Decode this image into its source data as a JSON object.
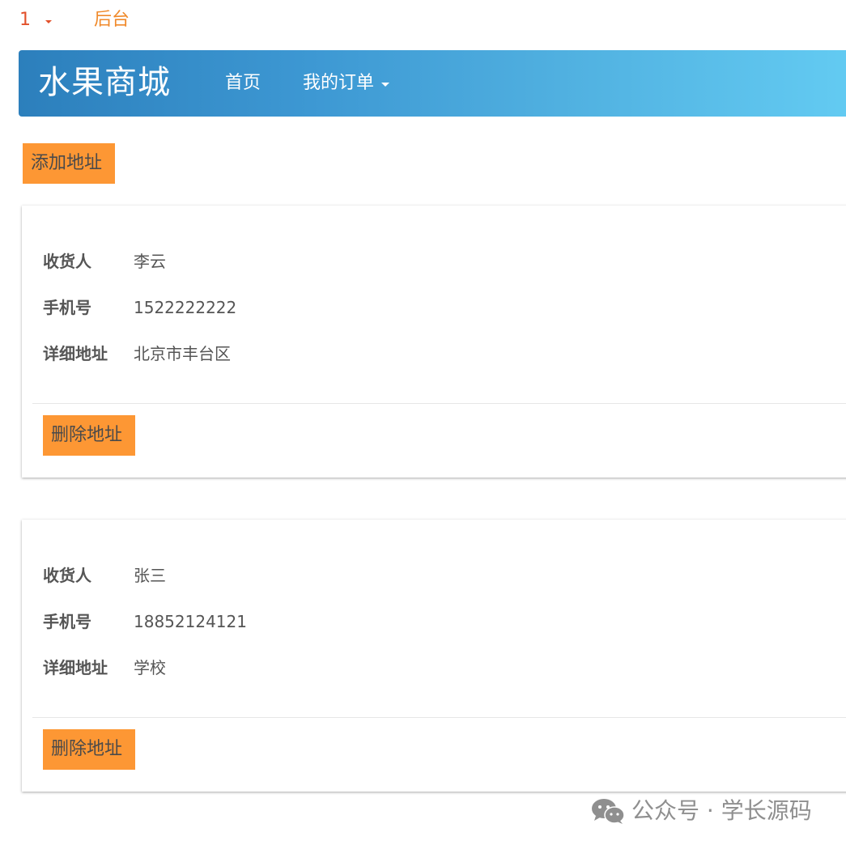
{
  "top": {
    "user": "1",
    "admin": "后台"
  },
  "navbar": {
    "brand": "水果商城",
    "home": "首页",
    "my_orders": "我的订单"
  },
  "add_address_label": "添加地址",
  "addresses": [
    {
      "receiver_label": "收货人",
      "receiver": "李云",
      "phone_label": "手机号",
      "phone": "1522222222",
      "detail_label": "详细地址",
      "detail": "北京市丰台区",
      "delete_label": "删除地址"
    },
    {
      "receiver_label": "收货人",
      "receiver": "张三",
      "phone_label": "手机号",
      "phone": "18852124121",
      "detail_label": "详细地址",
      "detail": "学校",
      "delete_label": "删除地址"
    }
  ],
  "watermark": {
    "text": "公众号 · 学长源码",
    "icon": "wechat-icon"
  },
  "colors": {
    "accent_orange": "#fd9734",
    "link_orange": "#f08a2b",
    "user_red": "#e2512b",
    "navbar_start": "#2c7fbc",
    "navbar_end": "#63cbf2"
  }
}
